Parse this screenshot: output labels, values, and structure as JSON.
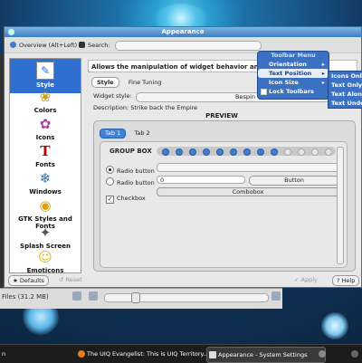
{
  "window": {
    "title": "Appearance"
  },
  "toolbar": {
    "overview_label": "Overview (Alt+Left)",
    "search_label": "Search:"
  },
  "sidebar": {
    "items": [
      {
        "label": "Style",
        "icon": "style-icon"
      },
      {
        "label": "Colors",
        "icon": "colors-icon"
      },
      {
        "label": "Icons",
        "icon": "icons-icon"
      },
      {
        "label": "Fonts",
        "icon": "fonts-icon"
      },
      {
        "label": "Windows",
        "icon": "windows-icon"
      },
      {
        "label": "GTK Styles and Fonts",
        "icon": "gtk-icon"
      },
      {
        "label": "Splash Screen",
        "icon": "splash-icon"
      },
      {
        "label": "Emoticons",
        "icon": "emoticons-icon"
      }
    ]
  },
  "content": {
    "description": "Allows the manipulation of widget behavior and changing t",
    "tabs": [
      "Style",
      "Fine Tuning"
    ],
    "widget_style_label": "Widget style:",
    "widget_style_value": "Bespin",
    "style_description": "Description: Strike back the Empire",
    "preview_title": "PREVIEW",
    "preview_tabs": [
      "Tab 1",
      "Tab 2"
    ],
    "groupbox_title": "GROUP BOX",
    "radio1": "Radio button",
    "radio2": "Radio button",
    "checkbox": "Checkbox",
    "spin_value": "0",
    "button_label": "Button",
    "combobox_label": "Combobox"
  },
  "menu": {
    "title": "Toolbar Menu",
    "items": [
      "Orientation",
      "Text Position",
      "Icon Size",
      "Lock Toolbars"
    ]
  },
  "submenu": {
    "items": [
      "Icons Only",
      "Text Only",
      "Text Alongside",
      "Text Under"
    ]
  },
  "bottom": {
    "defaults": "Defaults",
    "reset": "Reset",
    "apply": "Apply",
    "help": "Help"
  },
  "background": {
    "files_label": "Files (31.2 MB)"
  },
  "taskbar": {
    "items": [
      "n",
      "The UIQ Evangelist: This is UIQ Territory...",
      "Appearance - System Settings"
    ]
  },
  "colors": {
    "accent": "#2f6fcf",
    "menu_bg": "#3a71c2"
  }
}
